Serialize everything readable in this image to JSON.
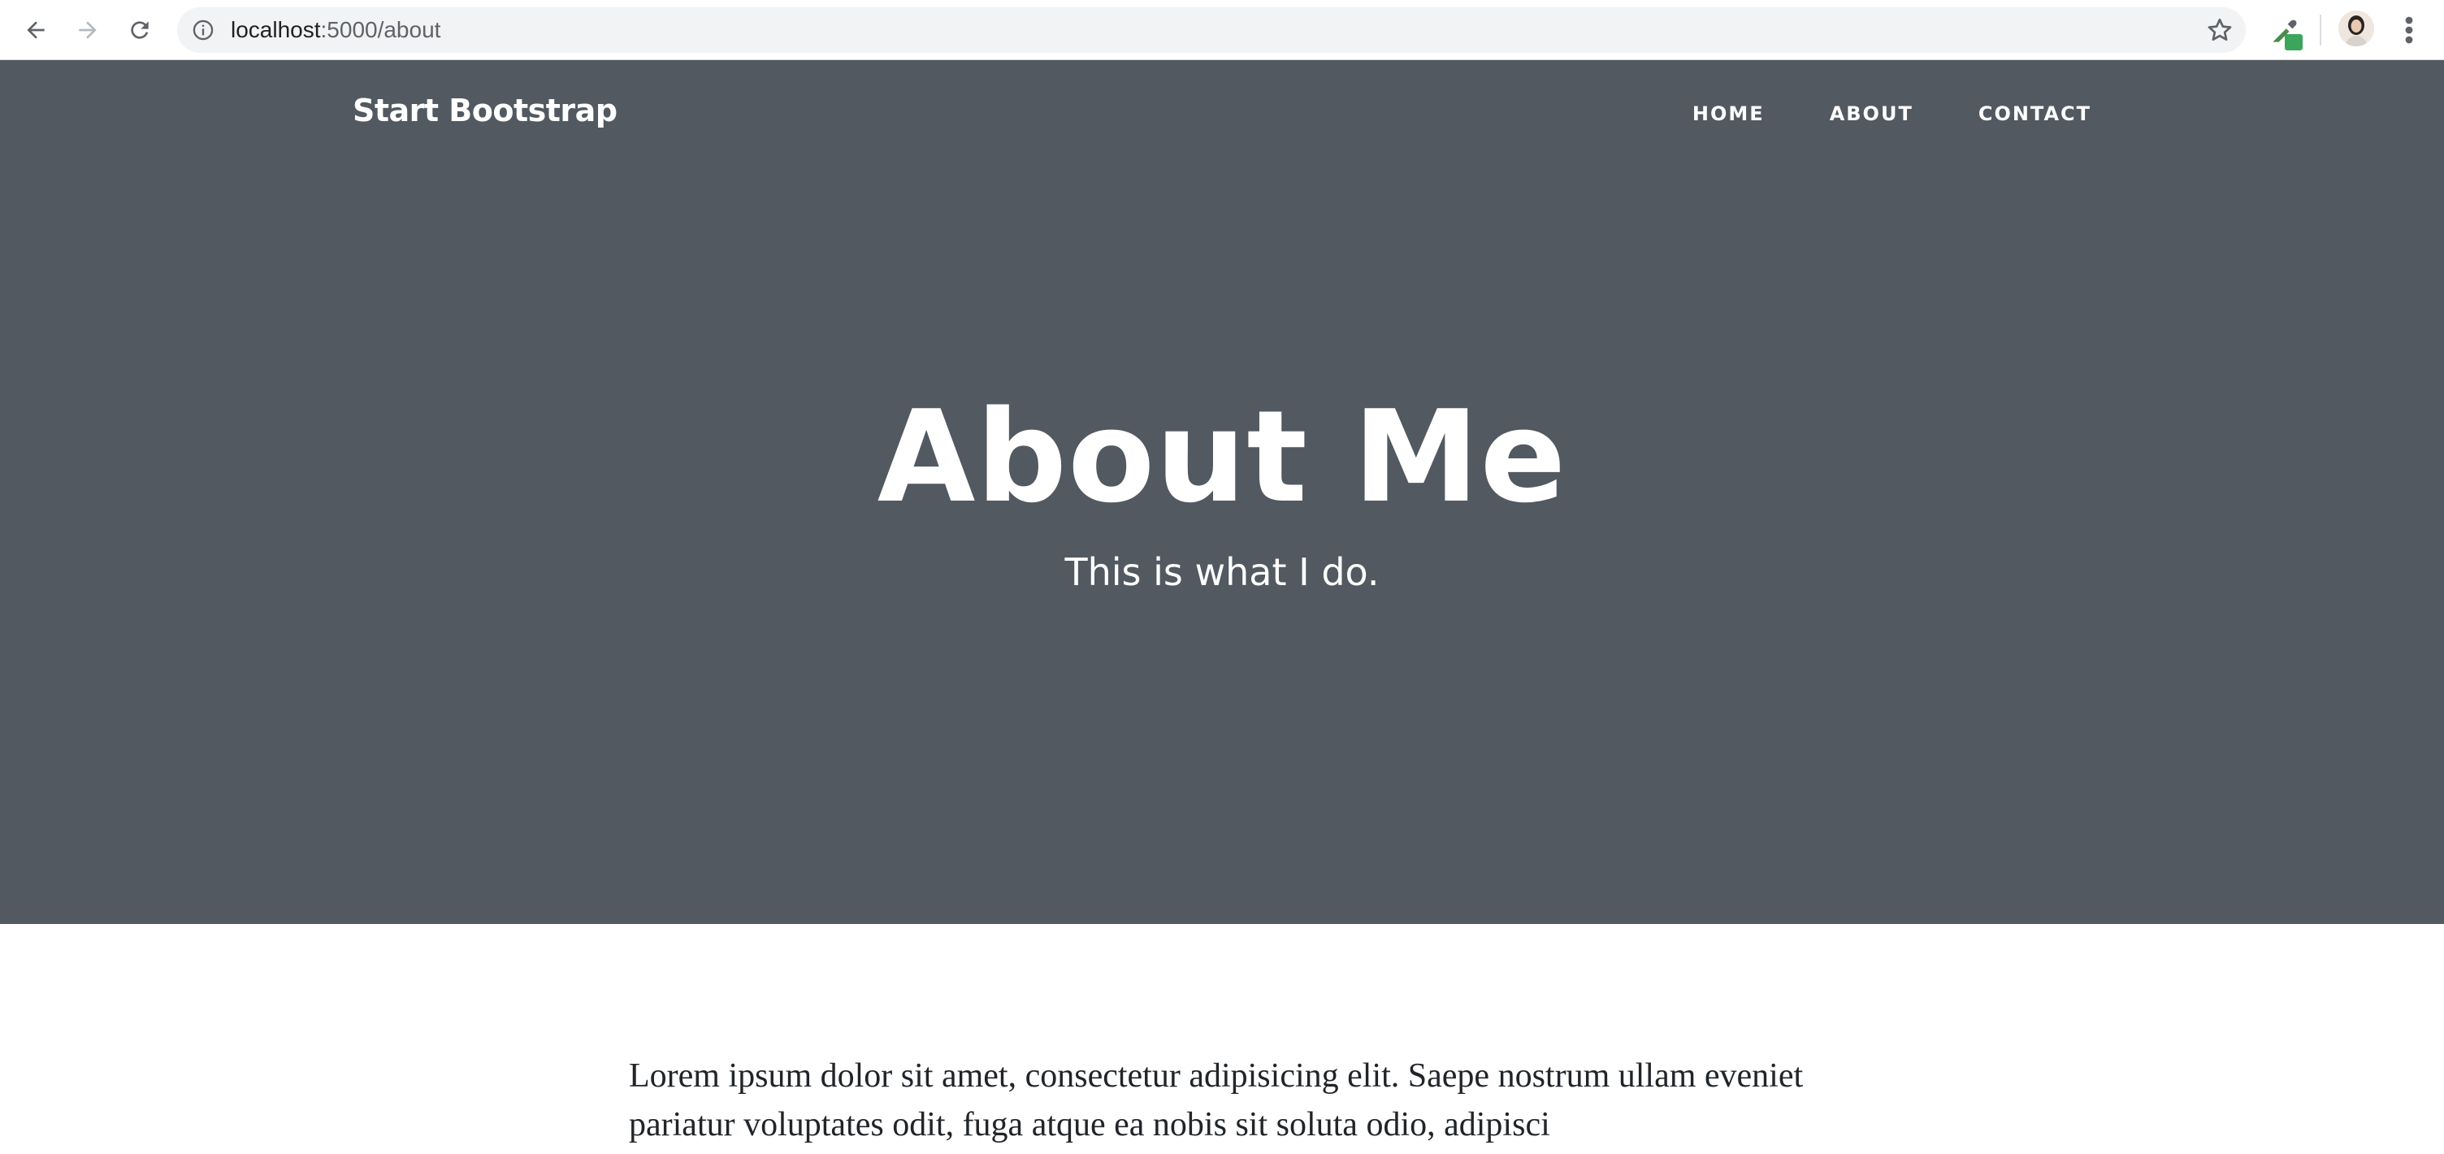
{
  "browser": {
    "url_host": "localhost",
    "url_path": ":5000/about",
    "icons": {
      "back": "arrow-left-icon",
      "forward": "arrow-right-icon",
      "reload": "reload-icon",
      "info": "info-icon",
      "bookmark": "star-icon",
      "extension": "eyedropper-icon",
      "profile": "avatar",
      "menu": "more-vert-icon"
    }
  },
  "navbar": {
    "brand": "Start Bootstrap",
    "items": [
      {
        "label": "HOME"
      },
      {
        "label": "ABOUT"
      },
      {
        "label": "CONTACT"
      }
    ]
  },
  "hero": {
    "title": "About Me",
    "subtitle": "This is what I do.",
    "background": "#525960"
  },
  "content": {
    "paragraph": "Lorem ipsum dolor sit amet, consectetur adipisicing elit. Saepe nostrum ullam eveniet pariatur voluptates odit, fuga atque ea nobis sit soluta odio, adipisci"
  }
}
